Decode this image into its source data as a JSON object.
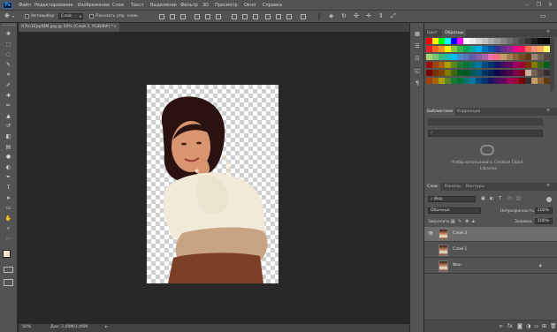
{
  "app": {
    "logo": "Ps"
  },
  "menu": {
    "items": [
      "Файл",
      "Редактирование",
      "Изображение",
      "Слои",
      "Текст",
      "Выделение",
      "Фильтр",
      "3D",
      "Просмотр",
      "Окно",
      "Справка"
    ]
  },
  "window_controls": {
    "minimize": "–",
    "restore": "❐",
    "close": "✕"
  },
  "options_bar": {
    "autoselect_label": "Автовыбор:",
    "autoselect_value": "Слой",
    "show_controls_label": "Показать упр. элем."
  },
  "document": {
    "tab_title": "X7tn1EJqdQM.jpg @ 50% (Слой 2, RGB/8#) *",
    "close": "×"
  },
  "status": {
    "zoom": "50%",
    "doc_info": "Док: 2,00M/1,06M"
  },
  "tools": [
    {
      "name": "move-tool-icon",
      "glyph": "✥"
    },
    {
      "name": "marquee-tool-icon",
      "glyph": "⬚"
    },
    {
      "name": "lasso-tool-icon",
      "glyph": "◌"
    },
    {
      "name": "quick-select-tool-icon",
      "glyph": "✎"
    },
    {
      "name": "crop-tool-icon",
      "glyph": "⌗"
    },
    {
      "name": "eyedropper-tool-icon",
      "glyph": "✐"
    },
    {
      "name": "healing-tool-icon",
      "glyph": "✚"
    },
    {
      "name": "brush-tool-icon",
      "glyph": "✏"
    },
    {
      "name": "stamp-tool-icon",
      "glyph": "▲"
    },
    {
      "name": "history-brush-tool-icon",
      "glyph": "↺"
    },
    {
      "name": "eraser-tool-icon",
      "glyph": "◧"
    },
    {
      "name": "gradient-tool-icon",
      "glyph": "▤"
    },
    {
      "name": "blur-tool-icon",
      "glyph": "●"
    },
    {
      "name": "dodge-tool-icon",
      "glyph": "◐"
    },
    {
      "name": "pen-tool-icon",
      "glyph": "✒"
    },
    {
      "name": "type-tool-icon",
      "glyph": "T"
    },
    {
      "name": "path-select-tool-icon",
      "glyph": "➤"
    },
    {
      "name": "shape-tool-icon",
      "glyph": "▭"
    },
    {
      "name": "hand-tool-icon",
      "glyph": "✋"
    },
    {
      "name": "zoom-tool-icon",
      "glyph": "⌕"
    },
    {
      "name": "more-tools-icon",
      "glyph": "⋯"
    }
  ],
  "colors": {
    "foreground": "#f4e8c8",
    "background": "#ffffff",
    "accent": "#31a8ff"
  },
  "panels": {
    "color_tab": "Цвет",
    "swatches_tab": "Образцы",
    "libraries_tab": "Библиотеки",
    "adjustments_tab": "Коррекция",
    "cc_message_line1": "Чтобы использовать Creative Cloud",
    "cc_message_line2": "Libraries",
    "layers_tab": "Слои",
    "channels_tab": "Каналы",
    "paths_tab": "Контуры",
    "filter_kind": "Вид",
    "blend_mode": "Обычные",
    "opacity_label": "Непрозрачность:",
    "opacity_value": "100%",
    "lock_label": "Закрепить:",
    "fill_label": "Заливка:",
    "fill_value": "100%",
    "layers": [
      {
        "name": "Слой 2",
        "selected": true,
        "visible": true,
        "locked": false
      },
      {
        "name": "Слой 1",
        "selected": false,
        "visible": false,
        "locked": false
      },
      {
        "name": "Фон",
        "selected": false,
        "visible": false,
        "locked": true
      }
    ],
    "swatches_rows": [
      [
        "#ff0000",
        "#ffff00",
        "#00ff00",
        "#00ffff",
        "#0000ff",
        "#ff00ff",
        "#ffffff",
        "#ebebeb",
        "#d6d6d6",
        "#c2c2c2",
        "#adadad",
        "#999999",
        "#858585",
        "#707070",
        "#5c5c5c",
        "#474747",
        "#333333",
        "#1f1f1f",
        "#0a0a0a",
        "#000000"
      ],
      [
        "#ee1d24",
        "#f26522",
        "#f7941d",
        "#fff200",
        "#8dc63f",
        "#39b54a",
        "#00a651",
        "#00a99d",
        "#00aeef",
        "#0072bc",
        "#0054a6",
        "#2e3192",
        "#662d91",
        "#92278f",
        "#ec008c",
        "#ed145b",
        "#f26c4f",
        "#f69679",
        "#fbaf5d",
        "#fff568"
      ],
      [
        "#acd373",
        "#7cc576",
        "#3cb878",
        "#1cbbb4",
        "#00bff3",
        "#448ccb",
        "#5574b9",
        "#605ca8",
        "#8560a8",
        "#a864a8",
        "#f06eaa",
        "#f26d7d",
        "#c69c6d",
        "#a67c52",
        "#8c6239",
        "#754c24",
        "#603913",
        "#998675",
        "#736357",
        "#534741"
      ],
      [
        "#9e0b0f",
        "#a0410d",
        "#a3620a",
        "#aba000",
        "#598527",
        "#197b30",
        "#007236",
        "#00746b",
        "#0076a3",
        "#004a80",
        "#003471",
        "#1b1464",
        "#440e62",
        "#630460",
        "#9e005d",
        "#9e0039",
        "#7b2e00",
        "#827b00",
        "#406618",
        "#005e20"
      ],
      [
        "#790000",
        "#7b2e00",
        "#7d4900",
        "#827b00",
        "#406618",
        "#005e20",
        "#005826",
        "#005952",
        "#005b7f",
        "#003663",
        "#002157",
        "#0d004c",
        "#32004b",
        "#4b0049",
        "#7b0046",
        "#7a0026",
        "#c7b299",
        "#736357",
        "#534741",
        "#362f2d"
      ],
      [
        "#a0410d",
        "#a3620a",
        "#aba000",
        "#598527",
        "#197b30",
        "#007236",
        "#00746b",
        "#0076a3",
        "#004a80",
        "#003471",
        "#1b1464",
        "#440e62",
        "#630460",
        "#9e005d",
        "#9e0039",
        "#790000",
        "#362f2d",
        "#c69c6d",
        "#8c6239",
        "#603913"
      ]
    ]
  }
}
